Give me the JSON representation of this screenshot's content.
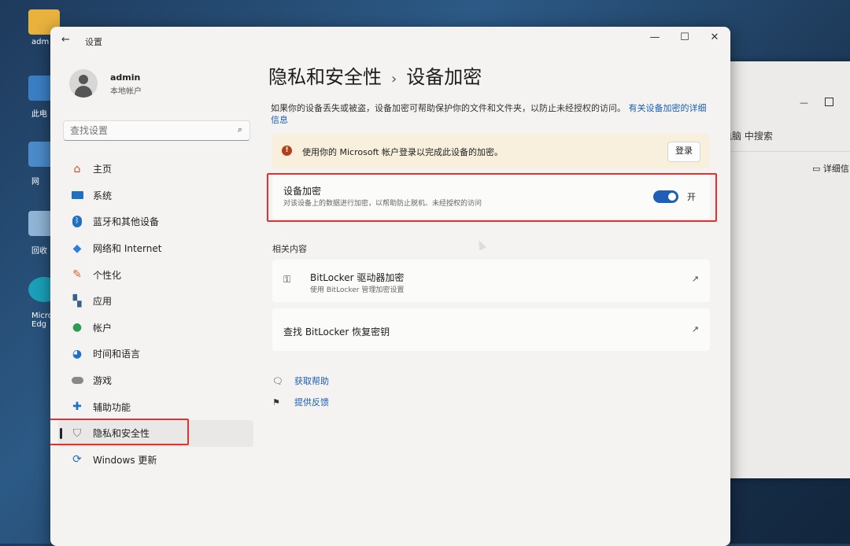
{
  "desktop": {
    "labels": [
      "adm",
      "此电",
      "网",
      "回收",
      "Micro Edg"
    ]
  },
  "background_window": {
    "search_text": "电脑 中搜索",
    "detail_text": "详细信"
  },
  "window": {
    "title": "设置",
    "controls": {
      "minimize": "—",
      "maximize": "☐",
      "close": "✕"
    }
  },
  "user": {
    "name": "admin",
    "type": "本地帐户"
  },
  "search": {
    "placeholder": "查找设置",
    "icon": "search-icon"
  },
  "sidebar": {
    "items": [
      {
        "label": "主页",
        "icon": "home-icon",
        "color": "#d2492d"
      },
      {
        "label": "系统",
        "icon": "monitor-icon",
        "color": "#1f6fc2"
      },
      {
        "label": "蓝牙和其他设备",
        "icon": "bluetooth-icon",
        "color": "#1f6fc2"
      },
      {
        "label": "网络和 Internet",
        "icon": "wifi-icon",
        "color": "#2b7fd8"
      },
      {
        "label": "个性化",
        "icon": "brush-icon",
        "color": "#d9622e"
      },
      {
        "label": "应用",
        "icon": "apps-icon",
        "color": "#3a5f8a"
      },
      {
        "label": "帐户",
        "icon": "person-icon",
        "color": "#2e9a55"
      },
      {
        "label": "时间和语言",
        "icon": "globe-clock-icon",
        "color": "#1f6fc2"
      },
      {
        "label": "游戏",
        "icon": "gamepad-icon",
        "color": "#888888"
      },
      {
        "label": "辅助功能",
        "icon": "accessibility-icon",
        "color": "#1f6fc2"
      },
      {
        "label": "隐私和安全性",
        "icon": "shield-icon",
        "color": "#777777",
        "active": true
      },
      {
        "label": "Windows 更新",
        "icon": "update-icon",
        "color": "#1f6fc2"
      }
    ]
  },
  "breadcrumb": {
    "parent": "隐私和安全性",
    "separator": "›",
    "current": "设备加密"
  },
  "description": {
    "text": "如果你的设备丢失或被盗，设备加密可帮助保护你的文件和文件夹，以防止未经授权的访问。",
    "link": "有关设备加密的详细信息"
  },
  "warning": {
    "icon": "!",
    "text": "使用你的 Microsoft 帐户登录以完成此设备的加密。",
    "button": "登录"
  },
  "encryption": {
    "title": "设备加密",
    "subtitle": "对该设备上的数据进行加密，以帮助防止脱机、未经授权的访问",
    "toggle_on": true,
    "toggle_label": "开"
  },
  "related": {
    "heading": "相关内容",
    "items": [
      {
        "title": "BitLocker 驱动器加密",
        "subtitle": "使用 BitLocker 管理加密设置",
        "icon": "key-icon",
        "external": "↗"
      },
      {
        "title": "查找 BitLocker 恢复密钥",
        "external": "↗"
      }
    ]
  },
  "help": [
    {
      "label": "获取帮助",
      "icon": "help-icon"
    },
    {
      "label": "提供反馈",
      "icon": "feedback-icon"
    }
  ],
  "accent_colors": {
    "highlight_box": "#e53030",
    "toggle": "#1f5fb8",
    "link": "#1a5fb4"
  }
}
